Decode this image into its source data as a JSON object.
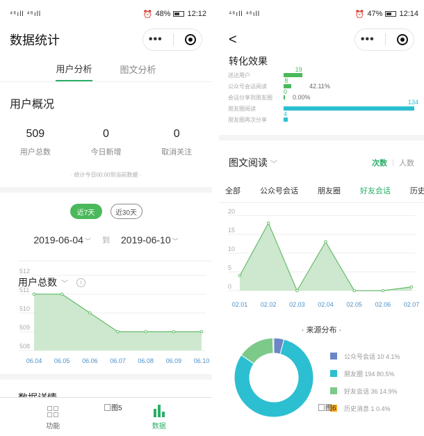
{
  "left": {
    "status": {
      "signal": "⁴⁶ıll ⁴⁶ıll",
      "battery": "48%",
      "time": "12:12"
    },
    "nav": {
      "title": "数据统计",
      "more": "•••"
    },
    "tabs": [
      "用户分析",
      "图文分析"
    ],
    "overview": {
      "title": "用户概况",
      "items": [
        {
          "value": "509",
          "label": "用户总数"
        },
        {
          "value": "0",
          "label": "今日新增"
        },
        {
          "value": "0",
          "label": "取消关注"
        }
      ],
      "note": "·  统计今日00:00到当前数据  ·"
    },
    "range": {
      "btn7": "近7天",
      "btn30": "近30天",
      "start": "2019-06-04",
      "to": "到",
      "end": "2019-06-10"
    },
    "chart_title": "用户总数",
    "section_peek": "数据详情",
    "tabbar": {
      "feature": "功能",
      "data": "数据",
      "alt": "图5"
    }
  },
  "right": {
    "status": {
      "signal": "⁴⁶ıll ⁴⁶ıll",
      "battery": "47%",
      "time": "12:14"
    },
    "conversion": {
      "title": "转化效果",
      "rows": [
        {
          "label": "送达用户",
          "value": "19",
          "pct": ""
        },
        {
          "label": "公众号会话阅读",
          "value": "8",
          "pct": "42.11%"
        },
        {
          "label": "会话分享到朋友圈",
          "value": "0",
          "pct": "0.00%"
        },
        {
          "label": "朋友圈阅读",
          "value": "134",
          "pct": ""
        },
        {
          "label": "朋友圈再次分享",
          "value": "4",
          "pct": ""
        }
      ]
    },
    "reading": {
      "title": "图文阅读",
      "mode_on": "次数",
      "mode_off": "人数"
    },
    "channels": [
      "全部",
      "公众号会话",
      "朋友圈",
      "好友会话",
      "历史消"
    ],
    "source": {
      "title": "·  来源分布  ·",
      "items": [
        {
          "label": "公众号会话  10  4.1%",
          "color": "#6c86c6",
          "value": 10
        },
        {
          "label": "朋友圈  194  80.5%",
          "color": "#2cbfd1",
          "value": 194
        },
        {
          "label": "好友会话  36  14.9%",
          "color": "#7dc98a",
          "value": 36
        },
        {
          "label": "历史消息  1  0.4%",
          "color": "#f5a623",
          "value": 1
        }
      ]
    },
    "alt": "图6"
  },
  "chart_data": [
    {
      "type": "area",
      "title": "用户总数",
      "categories": [
        "06.04",
        "06.05",
        "06.06",
        "06.07",
        "06.08",
        "06.09",
        "06.10"
      ],
      "values": [
        511,
        511,
        510,
        509,
        509,
        509,
        509
      ],
      "ylim": [
        508,
        512
      ],
      "yticks": [
        "508",
        "509",
        "510",
        "511",
        "512"
      ],
      "color": "#66bb6a",
      "grid": true
    },
    {
      "type": "area",
      "title": "图文阅读",
      "categories": [
        "02.01",
        "02.02",
        "02.03",
        "02.04",
        "02.05",
        "02.06",
        "02.07"
      ],
      "values": [
        4,
        18,
        0,
        13,
        0,
        0,
        1
      ],
      "ylim": [
        0,
        20
      ],
      "yticks": [
        "0",
        "5",
        "10",
        "15",
        "20"
      ],
      "color": "#66bb6a",
      "grid": true
    },
    {
      "type": "pie",
      "title": "来源分布",
      "categories": [
        "公众号会话",
        "朋友圈",
        "好友会话",
        "历史消息"
      ],
      "values": [
        10,
        194,
        36,
        1
      ],
      "colors": [
        "#6c86c6",
        "#2cbfd1",
        "#7dc98a",
        "#f5a623"
      ]
    }
  ]
}
